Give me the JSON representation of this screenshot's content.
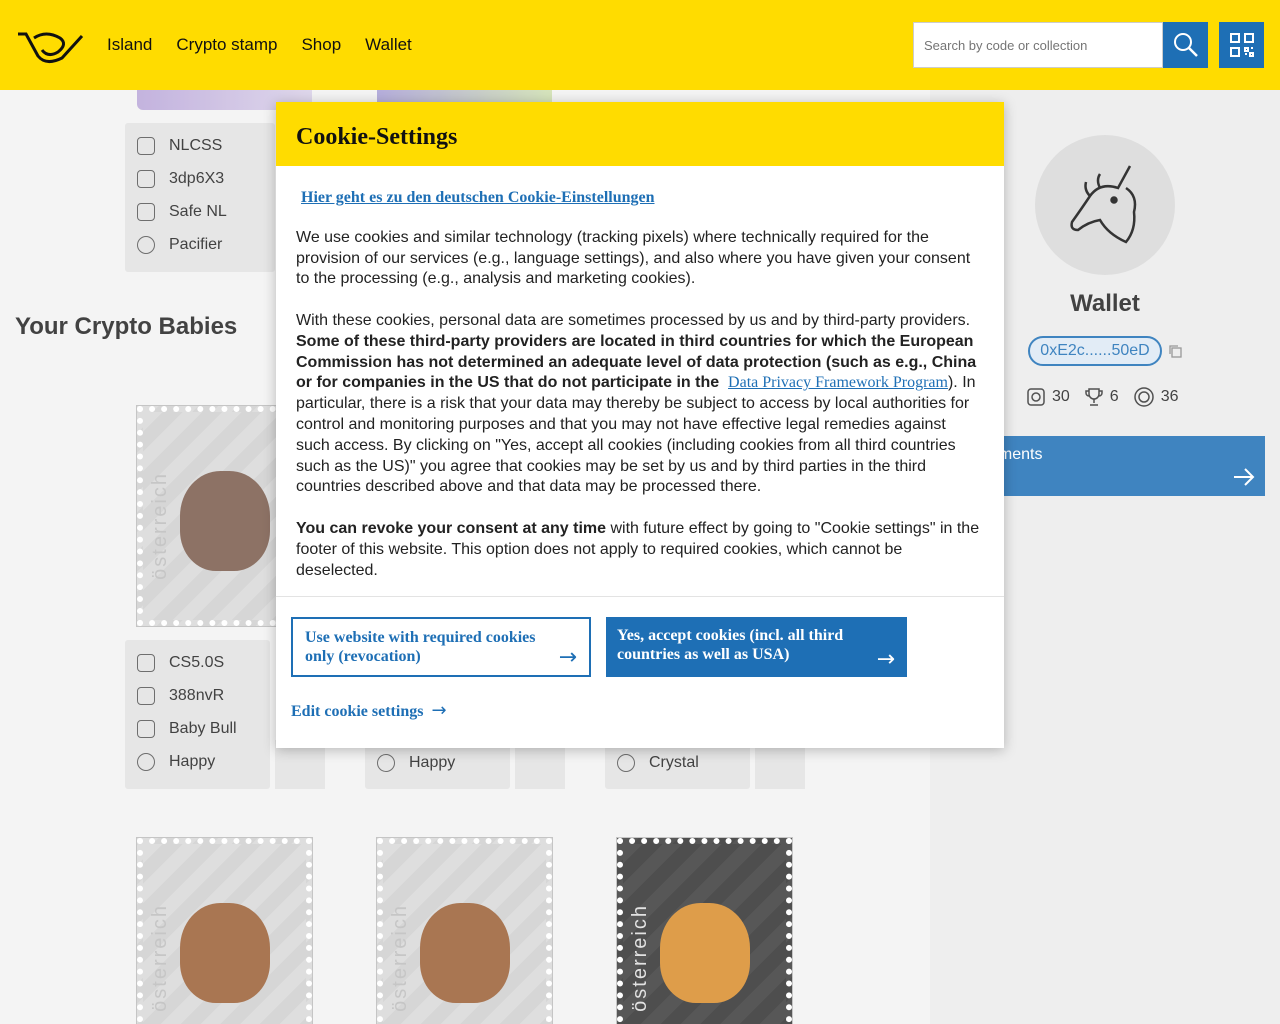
{
  "header": {
    "nav": [
      "Island",
      "Crypto stamp",
      "Shop",
      "Wallet"
    ],
    "search_placeholder": "Search by code or collection",
    "icons": [
      "post-horn-logo",
      "search-icon",
      "qr-code-icon"
    ],
    "brand_color": "#ffdc00",
    "accent_color": "#1e6fb5"
  },
  "background": {
    "top_card": {
      "rows": [
        "NLCSS",
        "3dp6X3",
        "Safe NL",
        "Pacifier"
      ]
    },
    "section_title": "Your Crypto Babies",
    "card1": {
      "rows": [
        "CS5.0S",
        "388nvR",
        "Baby Bull",
        "Happy"
      ]
    },
    "card2": {
      "rows": [
        "Happy"
      ]
    },
    "card3": {
      "rows": [
        "Crystal"
      ]
    },
    "stamp_text": "österreich",
    "wallet": {
      "title": "Wallet",
      "address": "0xE2c......50eD",
      "stats": [
        "30",
        "6",
        "36"
      ],
      "achievements_label": "ements"
    }
  },
  "modal": {
    "title": "Cookie-Settings",
    "german_link": "Hier geht es zu den deutschen Cookie-Einstellungen",
    "para1": "We use cookies and similar technology (tracking pixels) where technically required for the provision of our services (e.g., language settings), and also where you have given your consent to the processing (e.g., analysis and marketing cookies).",
    "para2_intro": "With these cookies, personal data are sometimes processed by us and by third-party providers.",
    "para2_bold": "Some of these third-party providers are located in third countries for which the European Commission has not determined an adequate level of data protection (such as e.g., China or for companies in the US that do not participate in the",
    "dpf_link": "Data Privacy Framework Program",
    "para2_rest": "In particular, there is a risk that your data may thereby be subject to access by local authorities for control and monitoring purposes and that you may not have effective legal remedies against such access. By clicking on \"Yes, accept all cookies (including cookies from all third countries such as the US)\" you agree that cookies may be set by us and by third parties in the third countries described above and that data may be processed there.",
    "para3_bold": "You can revoke your consent at any time",
    "para3_rest": "with future effect by going to \"Cookie settings\" in the footer of this website. This option does not apply to required cookies, which cannot be deselected.",
    "btn_required": "Use website with required cookies only (revocation)",
    "btn_accept": "Yes, accept cookies (incl. all third countries as well as USA)",
    "edit_link": "Edit cookie settings",
    "arrow": "→"
  }
}
